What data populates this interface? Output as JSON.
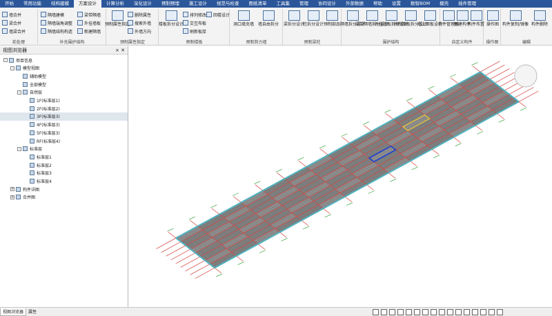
{
  "tabs": [
    "开始",
    "常用功能",
    "结构建模",
    "方案设计",
    "计算分析",
    "深化设计",
    "预制预埋",
    "施工设计",
    "规范与检查",
    "图纸清单",
    "工具集",
    "管理",
    "协同设计",
    "外部数据",
    "帮助",
    "设置",
    "数智BOM",
    "模壳",
    "插件管理"
  ],
  "active_tab_index": 3,
  "ribbon": {
    "small_buttons": [
      "墙合并",
      "梁合并",
      "墙梁合并",
      "隔墙建模",
      "隔墙端角调整",
      "隔墙结构构造",
      "梁带隔墙",
      "外挂墙板",
      "新建隔墙"
    ],
    "group_labels": [
      "前处理",
      "补充围护结构",
      "预制属性指定",
      "预制楼板",
      "预制剪力墙",
      "预制梁柱",
      "围护结构",
      "自定义构件",
      "操作图",
      "编辑"
    ],
    "big_buttons": [
      "预制属性指定",
      "删除属性",
      "搜索外墙",
      "外墙方向",
      "楼板拆分设计",
      "排列修改",
      "交互布板",
      "刷新板厚",
      "回楼设计",
      "洞口填充墙",
      "墙自由拆分",
      "梁拆分设计",
      "柱拆分设计",
      "预制部品",
      "隔墙拆分设计",
      "梁带隔墙拆分设计",
      "外挂墙板拆分设计",
      "预制飘板拆分设计",
      "墙上面板设计",
      "构件管理器",
      "新建构件",
      "构件布置",
      "操作图",
      "构件复制/镜像",
      "构件删除"
    ]
  },
  "browser": {
    "title": "视图浏览器",
    "close_symbol": "× ✕",
    "tree": [
      {
        "label": "项目信息",
        "level": 0,
        "expander": "-"
      },
      {
        "label": "模型视图",
        "level": 1,
        "expander": "-"
      },
      {
        "label": "辅助模型",
        "level": 2,
        "expander": ""
      },
      {
        "label": "全部模型",
        "level": 2,
        "expander": ""
      },
      {
        "label": "自然层",
        "level": 2,
        "expander": "-"
      },
      {
        "label": "1F(标准层1)",
        "level": 3,
        "expander": ""
      },
      {
        "label": "2F(标准层2)",
        "level": 3,
        "expander": ""
      },
      {
        "label": "3F(标准层3)",
        "level": 3,
        "expander": "",
        "selected": true
      },
      {
        "label": "4F(标准层3)",
        "level": 3,
        "expander": ""
      },
      {
        "label": "5F(标准层3)",
        "level": 3,
        "expander": ""
      },
      {
        "label": "RF(标准层4)",
        "level": 3,
        "expander": ""
      },
      {
        "label": "标准层",
        "level": 2,
        "expander": "-"
      },
      {
        "label": "标准层1",
        "level": 3,
        "expander": ""
      },
      {
        "label": "标准层2",
        "level": 3,
        "expander": ""
      },
      {
        "label": "标准层3",
        "level": 3,
        "expander": ""
      },
      {
        "label": "标准层4",
        "level": 3,
        "expander": ""
      },
      {
        "label": "构件详图",
        "level": 1,
        "expander": "+"
      },
      {
        "label": "合并图",
        "level": 1,
        "expander": "+"
      }
    ]
  },
  "bottom_tabs": [
    "视图浏览器",
    "属性"
  ],
  "colors": {
    "tabbar": "#2b569a",
    "selection": "#dfe7ee",
    "beam_red": "#d9534f",
    "wall_cyan": "#4fb3bf",
    "slab_gray": "#7d7d7d"
  }
}
